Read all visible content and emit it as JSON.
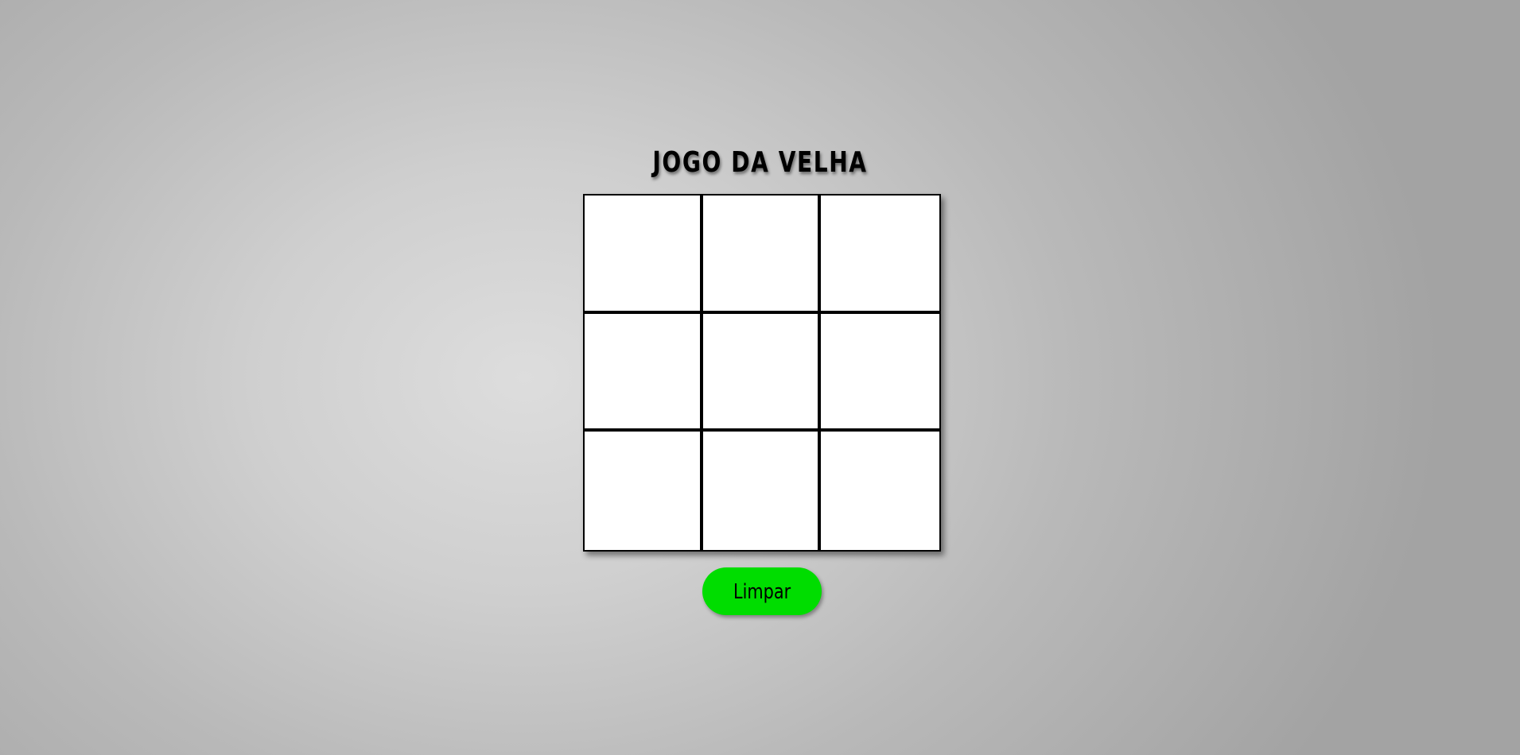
{
  "page": {
    "title": "JOGO DA VELHA"
  },
  "board": {
    "cells": [
      "",
      "",
      "",
      "",
      "",
      "",
      "",
      "",
      ""
    ]
  },
  "actions": {
    "clear_label": "Limpar"
  },
  "colors": {
    "button_bg": "#00dd00",
    "board_bg": "#ffffff",
    "grid_line": "#000000"
  }
}
